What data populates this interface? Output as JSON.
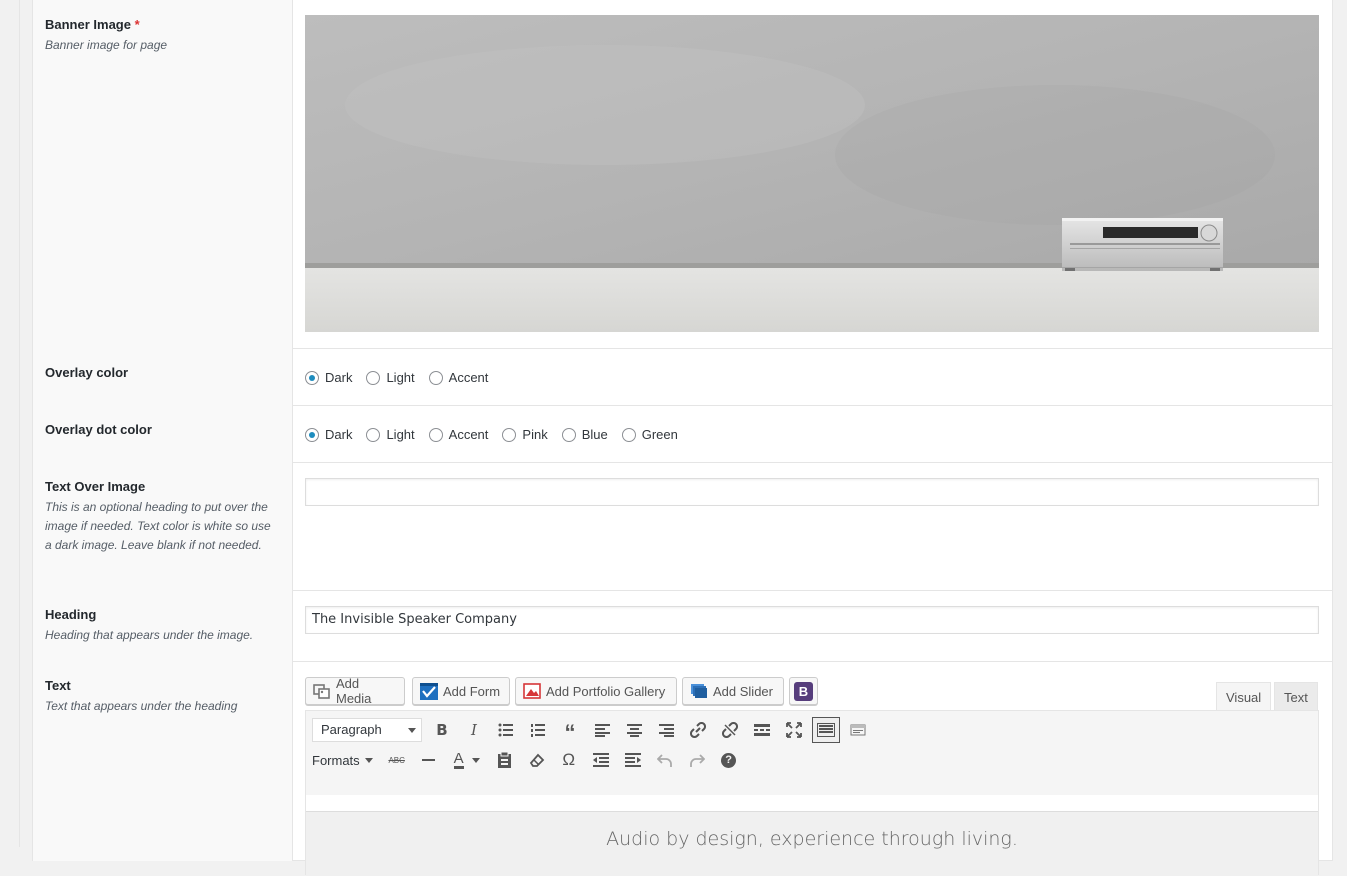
{
  "fields": {
    "banner": {
      "label": "Banner Image",
      "required_mark": "*",
      "description": "Banner image for page"
    },
    "overlay_color": {
      "label": "Overlay color",
      "options": [
        "Dark",
        "Light",
        "Accent"
      ],
      "selected": "Dark"
    },
    "overlay_dot_color": {
      "label": "Overlay dot color",
      "options": [
        "Dark",
        "Light",
        "Accent",
        "Pink",
        "Blue",
        "Green"
      ],
      "selected": "Dark"
    },
    "text_over_image": {
      "label": "Text Over Image",
      "description": "This is an optional heading to put over the image if needed. Text color is white so use a dark image. Leave blank if not needed.",
      "value": ""
    },
    "heading": {
      "label": "Heading",
      "description": "Heading that appears under the image.",
      "value": "The Invisible Speaker Company"
    },
    "text": {
      "label": "Text",
      "description": "Text that appears under the heading"
    }
  },
  "editor": {
    "media_buttons": [
      {
        "label": "Add Media",
        "icon": "media-icon"
      },
      {
        "label": "Add Form",
        "icon": "form-icon"
      },
      {
        "label": "Add Portfolio Gallery",
        "icon": "gallery-icon"
      },
      {
        "label": "Add Slider",
        "icon": "slider-icon"
      }
    ],
    "bootstrap_button": "B",
    "tabs": {
      "visual": "Visual",
      "text": "Text"
    },
    "format_select": "Paragraph",
    "formats_menu": "Formats",
    "content": "Audio by design, experience through living."
  },
  "colors": {
    "accent": "#1e8cbe",
    "required": "#dc3232",
    "bootstrap_purple": "#563d7c"
  }
}
